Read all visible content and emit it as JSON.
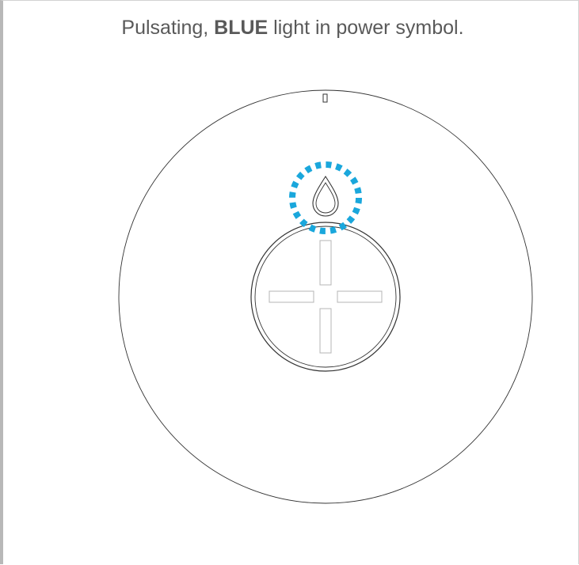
{
  "caption": {
    "before": "Pulsating, ",
    "emphasis": "BLUE",
    "after": " light in power symbol."
  },
  "colors": {
    "indicator_ring": "#1aa7dc",
    "outline": "#333333",
    "caption_text": "#595959"
  },
  "icons": {
    "power_symbol": "water-drop-icon",
    "center_button": "cross-slot-icon"
  }
}
